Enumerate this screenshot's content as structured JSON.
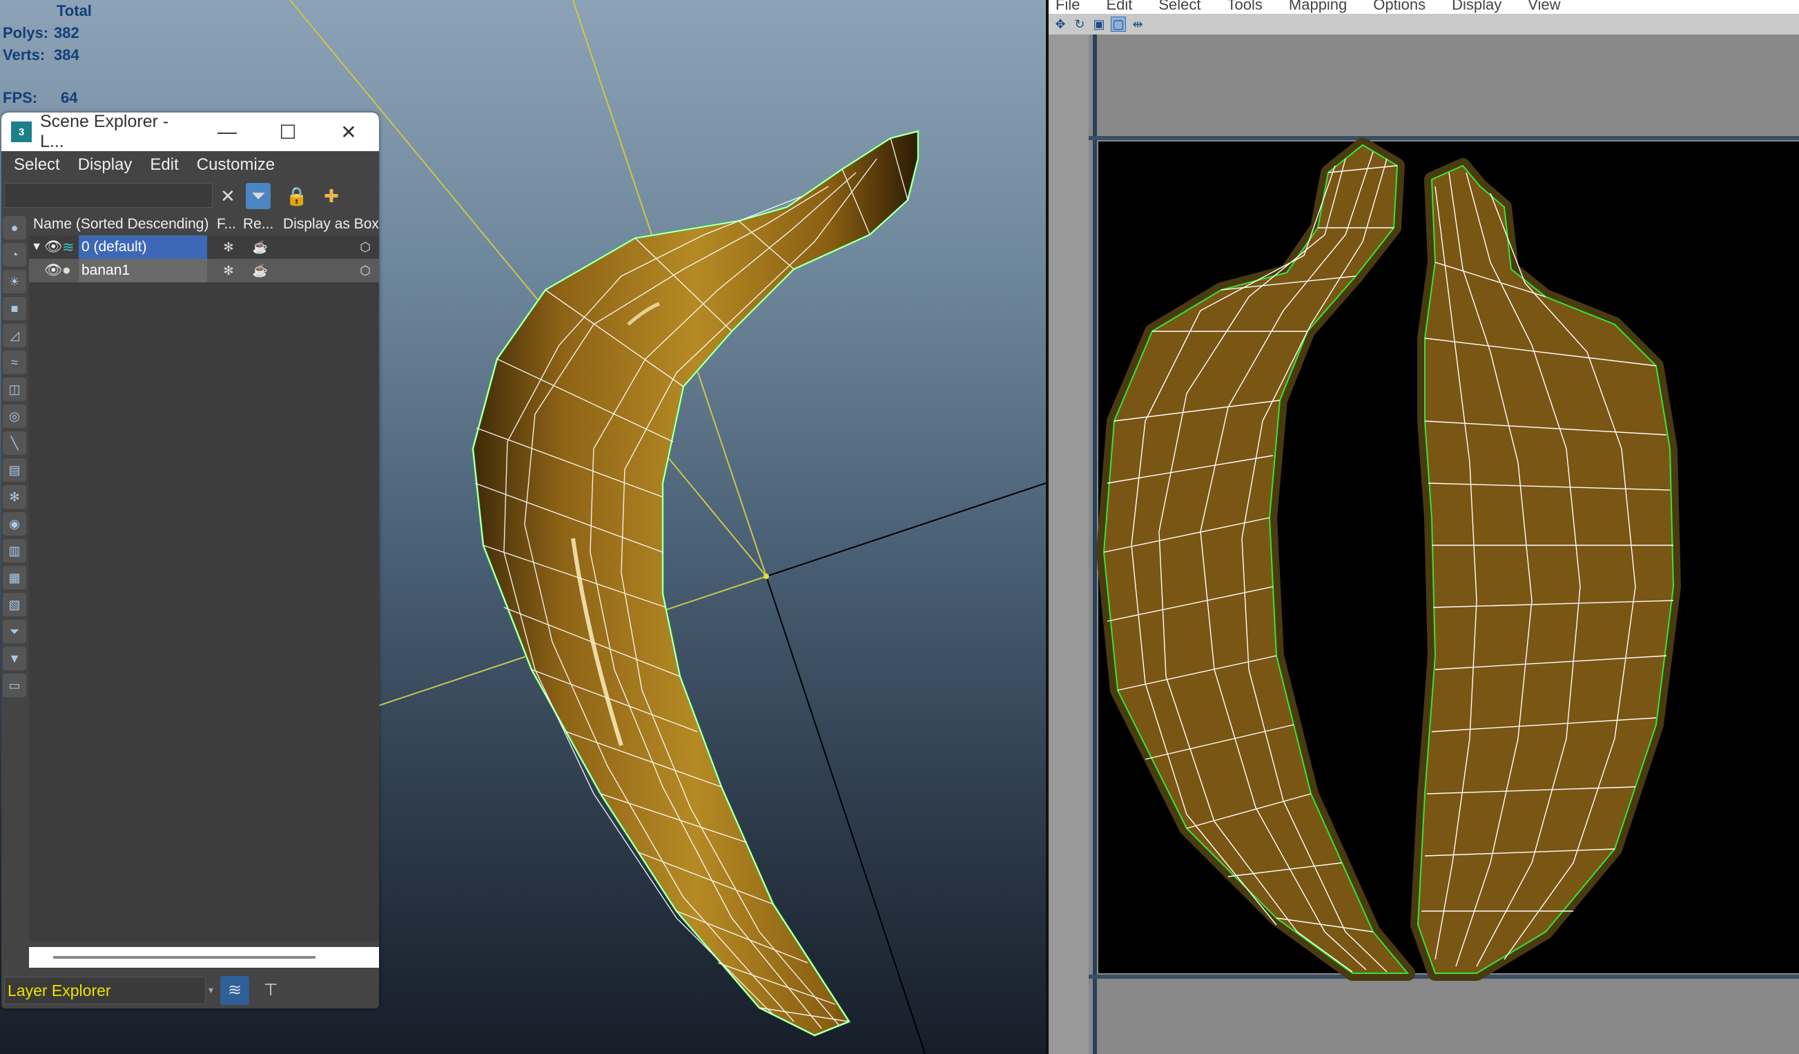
{
  "viewport": {
    "stats": {
      "total_label": "Total",
      "polys_label": "Polys:",
      "polys_value": "382",
      "verts_label": "Verts:",
      "verts_value": "384",
      "fps_label": "FPS:",
      "fps_value": "64"
    }
  },
  "scene_explorer": {
    "title": "Scene Explorer - L...",
    "logo_text": "3",
    "menu": [
      "Select",
      "Display",
      "Edit",
      "Customize"
    ],
    "columns": [
      "Name (Sorted Descending)",
      "F...",
      "Re...",
      "Display as Box"
    ],
    "rows": [
      {
        "name": "0 (default)"
      },
      {
        "name": "banan1"
      }
    ],
    "footer_dropdown": "Layer Explorer"
  },
  "uv_editor": {
    "menu": [
      "File",
      "Edit",
      "Select",
      "Tools",
      "Mapping",
      "Options",
      "Display",
      "View"
    ]
  },
  "colors": {
    "stats_text": "#123f7a",
    "layer_text": "#f0e000",
    "selection": "#3d68b8",
    "wire": "#ffffff",
    "outline": "#33e633",
    "banana": "#a8781c"
  },
  "icons": {
    "minimize": "minimize-icon",
    "maximize": "maximize-icon",
    "close": "close-icon",
    "eye": "eye-icon",
    "freeze": "snowflake-icon",
    "render": "teapot-icon",
    "box": "box-icon"
  }
}
